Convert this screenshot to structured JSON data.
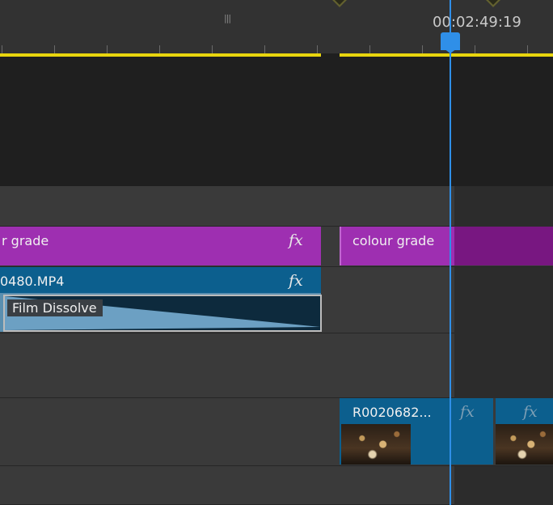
{
  "ruler": {
    "timecode": "00:02:49:19",
    "grip_label": "|||"
  },
  "tracks": {
    "v3": {
      "clip_left": {
        "label": "r grade",
        "fx": "fx"
      },
      "clip_right": {
        "label": "colour grade"
      }
    },
    "v2": {
      "clip": {
        "label": "0480.MP4",
        "fx": "fx"
      },
      "transition": {
        "label": "Film Dissolve"
      }
    },
    "v1": {
      "clip_a": {
        "label": "R0020682...",
        "fx": "fx"
      },
      "clip_b": {
        "fx": "fx"
      }
    }
  },
  "colors": {
    "playhead": "#2f8fe8",
    "work_area": "#e8d50e",
    "adjustment_clip": "#9e2fb1",
    "video_clip": "#0c5f8e"
  }
}
